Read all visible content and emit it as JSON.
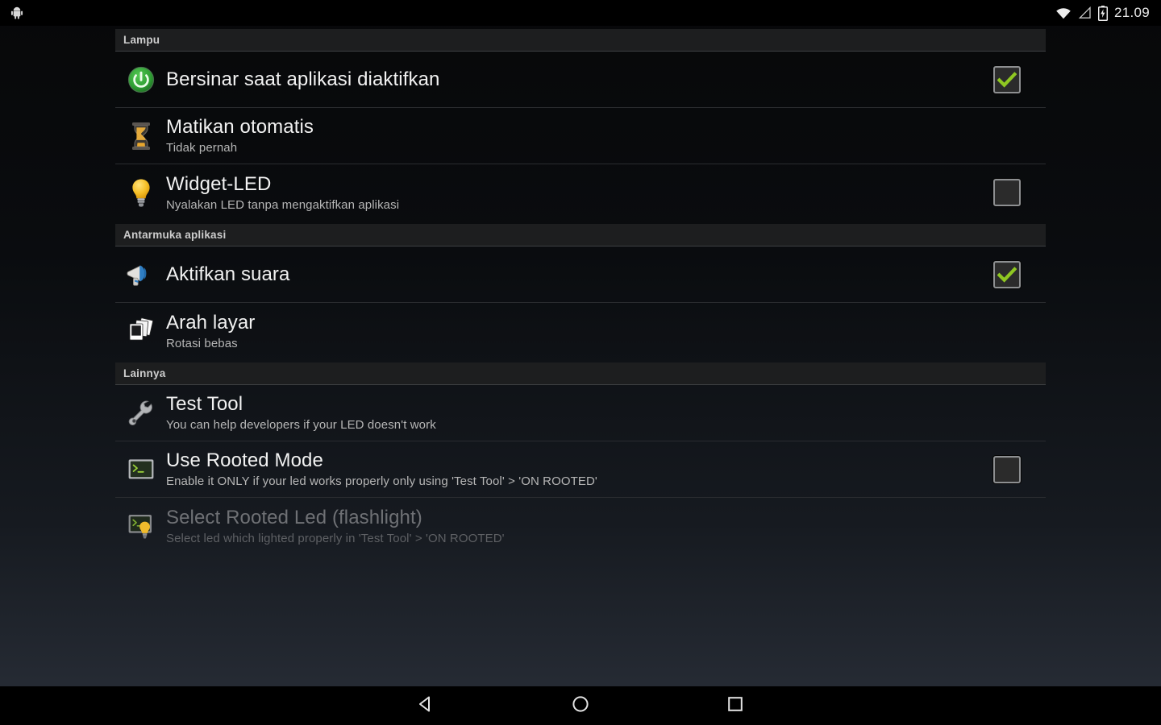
{
  "statusbar": {
    "app_icon": "android-robot-icon",
    "wifi_icon": "wifi-icon",
    "signal_icon": "signal-icon",
    "battery_icon": "battery-charging-icon",
    "clock": "21.09"
  },
  "sections": [
    {
      "header": "Lampu",
      "rows": [
        {
          "icon": "power-button-icon",
          "title": "Bersinar saat aplikasi diaktifkan",
          "subtitle": "",
          "widget": "checkbox",
          "checked": true,
          "enabled": true
        },
        {
          "icon": "hourglass-icon",
          "title": "Matikan otomatis",
          "subtitle": "Tidak pernah",
          "widget": "none",
          "checked": false,
          "enabled": true
        },
        {
          "icon": "lightbulb-icon",
          "title": "Widget-LED",
          "subtitle": "Nyalakan LED tanpa mengaktifkan aplikasi",
          "widget": "checkbox",
          "checked": false,
          "enabled": true
        }
      ]
    },
    {
      "header": "Antarmuka aplikasi",
      "rows": [
        {
          "icon": "megaphone-icon",
          "title": "Aktifkan suara",
          "subtitle": "",
          "widget": "checkbox",
          "checked": true,
          "enabled": true
        },
        {
          "icon": "photo-stack-icon",
          "title": "Arah layar",
          "subtitle": "Rotasi bebas",
          "widget": "none",
          "checked": false,
          "enabled": true
        }
      ]
    },
    {
      "header": "Lainnya",
      "rows": [
        {
          "icon": "wrench-icon",
          "title": "Test Tool",
          "subtitle": "You can help developers if your LED doesn't work",
          "widget": "none",
          "checked": false,
          "enabled": true
        },
        {
          "icon": "terminal-icon",
          "title": "Use Rooted Mode",
          "subtitle": "Enable it ONLY if your led works properly only using 'Test Tool' > 'ON ROOTED'",
          "widget": "checkbox",
          "checked": false,
          "enabled": true
        },
        {
          "icon": "terminal-bulb-icon",
          "title": "Select Rooted Led (flashlight)",
          "subtitle": "Select led which lighted properly in 'Test Tool' > 'ON ROOTED'",
          "widget": "none",
          "checked": false,
          "enabled": false
        }
      ]
    }
  ],
  "navbar": {
    "back_label": "back-icon",
    "home_label": "home-icon",
    "recents_label": "recents-icon"
  },
  "colors": {
    "accent_green": "#8fc722",
    "background_top": "#070809",
    "background_bottom": "#262b34",
    "section_header_bg": "#1d1e1f",
    "title_text": "#f2f2f2",
    "subtitle_text": "#b6b6b6",
    "disabled_text": "#6f7175"
  }
}
